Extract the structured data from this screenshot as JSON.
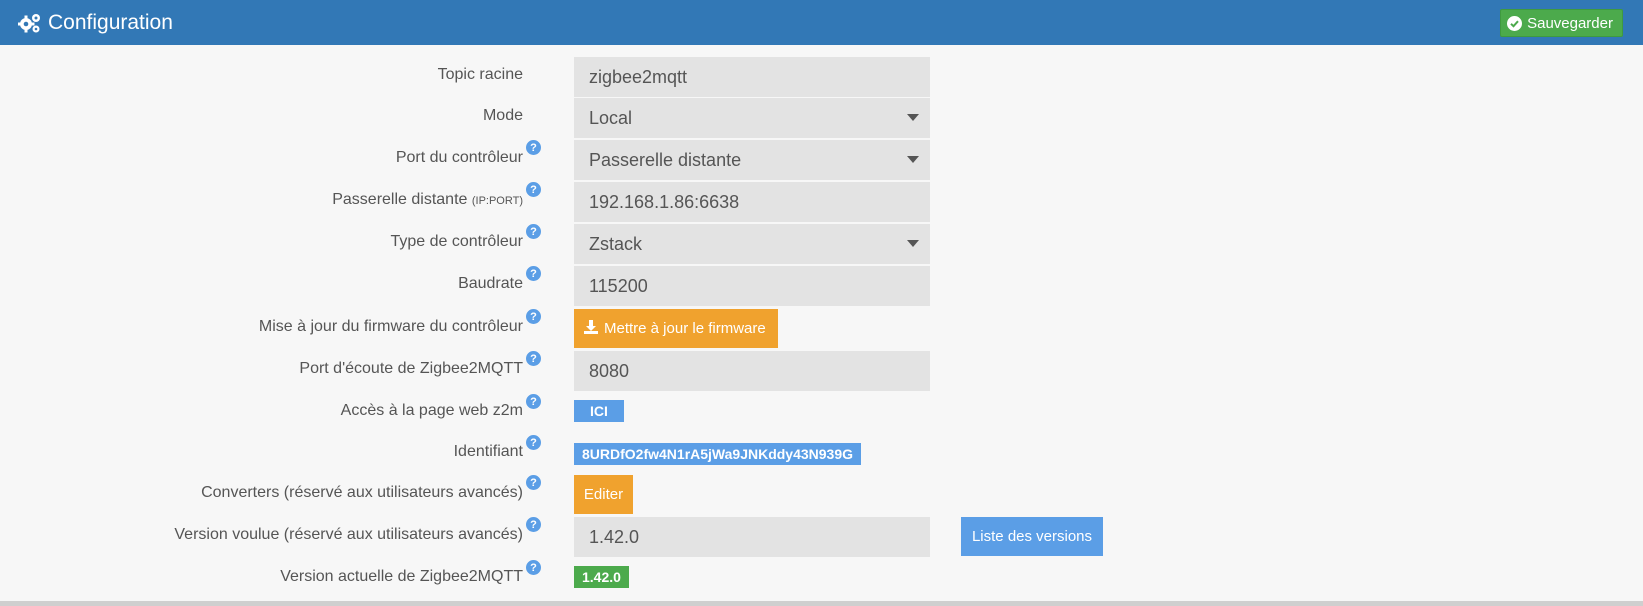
{
  "header": {
    "title": "Configuration",
    "save_label": "Sauvegarder"
  },
  "form": {
    "topic": {
      "label": "Topic racine",
      "value": "zigbee2mqtt"
    },
    "mode": {
      "label": "Mode",
      "value": "Local"
    },
    "port": {
      "label": "Port du contrôleur",
      "value": "Passerelle distante"
    },
    "remote": {
      "label": "Passerelle distante",
      "label_hint": "(IP:PORT)",
      "value": "192.168.1.86:6638"
    },
    "type": {
      "label": "Type de contrôleur",
      "value": "Zstack"
    },
    "baudrate": {
      "label": "Baudrate",
      "value": "115200"
    },
    "firmware": {
      "label": "Mise à jour du firmware du contrôleur",
      "button": "Mettre à jour le firmware"
    },
    "listen_port": {
      "label": "Port d'écoute de Zigbee2MQTT",
      "value": "8080"
    },
    "web": {
      "label": "Accès à la page web z2m",
      "link": "ICI"
    },
    "identifier": {
      "label": "Identifiant",
      "value": "8URDfO2fw4N1rA5jWa9JNKddy43N939G"
    },
    "converters": {
      "label": "Converters (réservé aux utilisateurs avancés)",
      "button": "Editer"
    },
    "wanted_version": {
      "label": "Version voulue (réservé aux utilisateurs avancés)",
      "value": "1.42.0",
      "button": "Liste des versions"
    },
    "current_version": {
      "label": "Version actuelle de Zigbee2MQTT",
      "value": "1.42.0"
    }
  },
  "icons": {
    "help": "question-circle-icon",
    "title": "cogs-icon",
    "save": "check-circle-icon",
    "firmware": "download-icon"
  },
  "colors": {
    "header": "#3278b6",
    "save": "#4caa4c",
    "orange": "#f0a22e",
    "blue": "#5b9ee6",
    "green": "#4caa4c"
  }
}
